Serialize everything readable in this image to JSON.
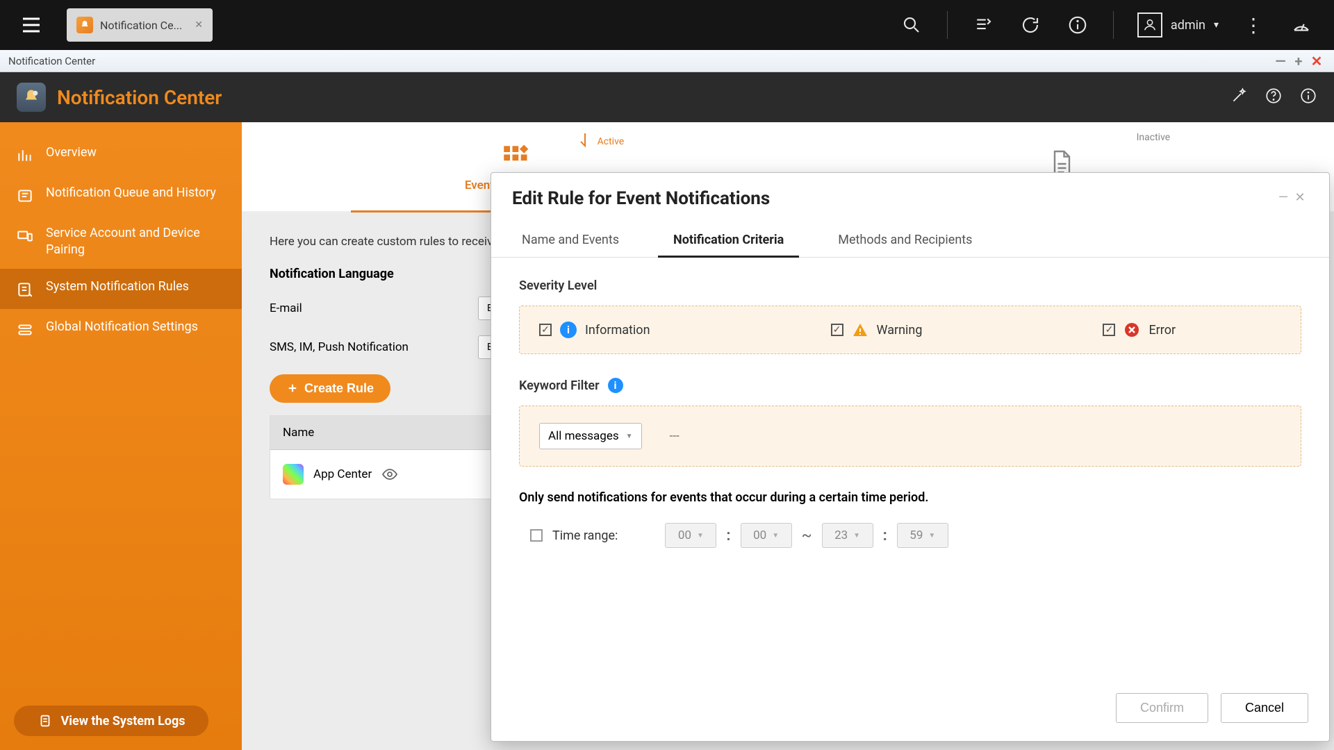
{
  "nas": {
    "tab_title": "Notification Ce...",
    "user_name": "admin"
  },
  "window": {
    "title": "Notification Center"
  },
  "app": {
    "title": "Notification Center"
  },
  "sidebar": {
    "items": [
      {
        "label": "Overview"
      },
      {
        "label": "Notification Queue and History"
      },
      {
        "label": "Service Account and Device Pairing"
      },
      {
        "label": "System Notification Rules"
      },
      {
        "label": "Global Notification Settings"
      }
    ],
    "syslog_button": "View the System Logs"
  },
  "main": {
    "top_tabs": [
      {
        "label": "Event Notifications",
        "status": "Active"
      },
      {
        "label": "",
        "status": "Inactive"
      }
    ],
    "description": "Here you can create custom rules to receive notifications based on event type, keyword, or time range. You can also specify notification method, contents, languages, and recipients.",
    "lang_section_title": "Notification Language",
    "form": {
      "email_label": "E-mail",
      "email_value": "English",
      "sms_label": "SMS, IM, Push Notification",
      "sms_value": "English"
    },
    "create_rule": "Create Rule",
    "table": {
      "header_name": "Name",
      "row1": "App Center"
    }
  },
  "dialog": {
    "title": "Edit Rule for Event Notifications",
    "tabs": [
      "Name and Events",
      "Notification Criteria",
      "Methods and Recipients"
    ],
    "severity": {
      "heading": "Severity Level",
      "items": [
        "Information",
        "Warning",
        "Error"
      ]
    },
    "keyword": {
      "heading": "Keyword Filter",
      "dropdown": "All messages",
      "value": "---"
    },
    "time": {
      "heading": "Only send notifications for events that occur during a certain time period.",
      "label": "Time range:",
      "from_h": "00",
      "from_m": "00",
      "to_h": "23",
      "to_m": "59"
    },
    "buttons": {
      "confirm": "Confirm",
      "cancel": "Cancel"
    }
  }
}
